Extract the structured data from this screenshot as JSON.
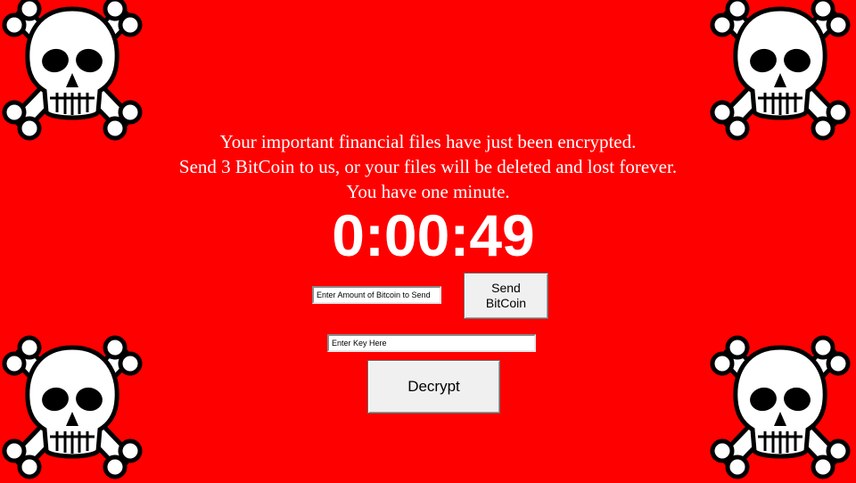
{
  "message": {
    "line1": "Your important financial files have just been encrypted.",
    "line2": "Send 3 BitCoin to us, or your files will be deleted and lost forever.",
    "line3": "You have one minute."
  },
  "timer": {
    "value": "0:00:49"
  },
  "amount_input": {
    "placeholder": "Enter Amount of Bitcoin to Send",
    "value": ""
  },
  "send_button": {
    "line1": "Send",
    "line2": "BitCoin"
  },
  "key_input": {
    "placeholder": "Enter Key Here",
    "value": ""
  },
  "decrypt_button": {
    "label": "Decrypt"
  },
  "decorations": {
    "icon": "skull-and-crossbones-icon"
  },
  "colors": {
    "background": "#ff0000",
    "text": "#ffffff",
    "button_face": "#f0f0f0"
  }
}
